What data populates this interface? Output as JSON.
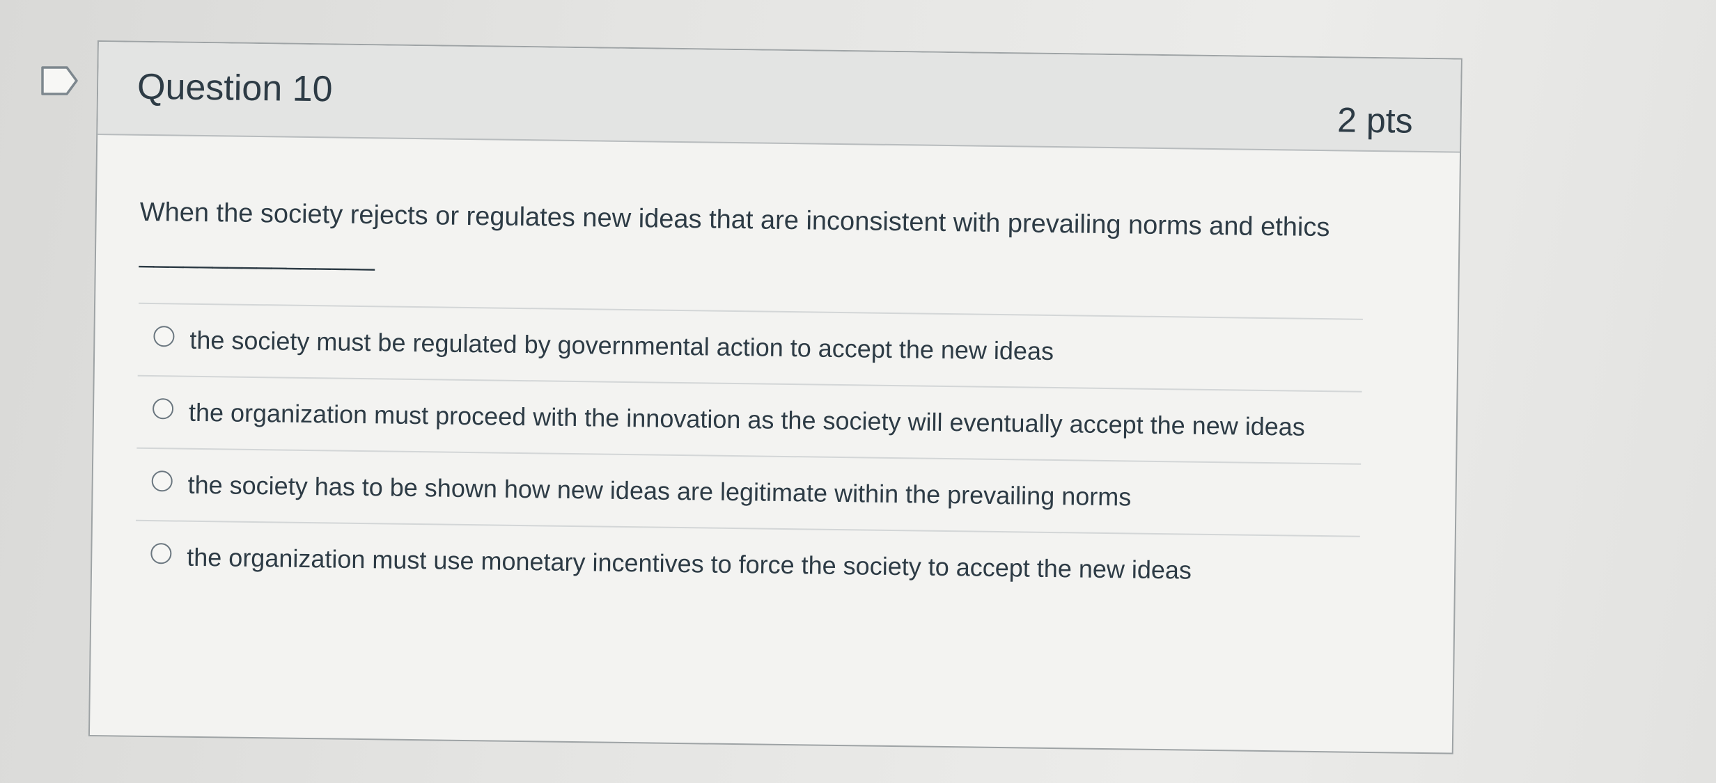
{
  "question": {
    "title": "Question 10",
    "points": "2 pts",
    "text": "When the society rejects or regulates new ideas that are inconsistent with prevailing norms and ethics ________________",
    "answers": [
      {
        "label": "the society must be regulated by governmental action to accept the new ideas",
        "selected": false
      },
      {
        "label": "the organization must proceed with the innovation as the society will eventually accept the new ideas",
        "selected": false
      },
      {
        "label": "the society has to be shown how new ideas are legitimate within the prevailing norms",
        "selected": false
      },
      {
        "label": "the organization must use monetary incentives to force the society to accept the new ideas",
        "selected": false
      }
    ]
  },
  "icons": {
    "flag": "flag-question-icon"
  },
  "colors": {
    "text": "#2d3b45",
    "header_bg": "#e3e4e3",
    "card_bg": "#f3f3f1",
    "border": "#9ea3a5"
  }
}
